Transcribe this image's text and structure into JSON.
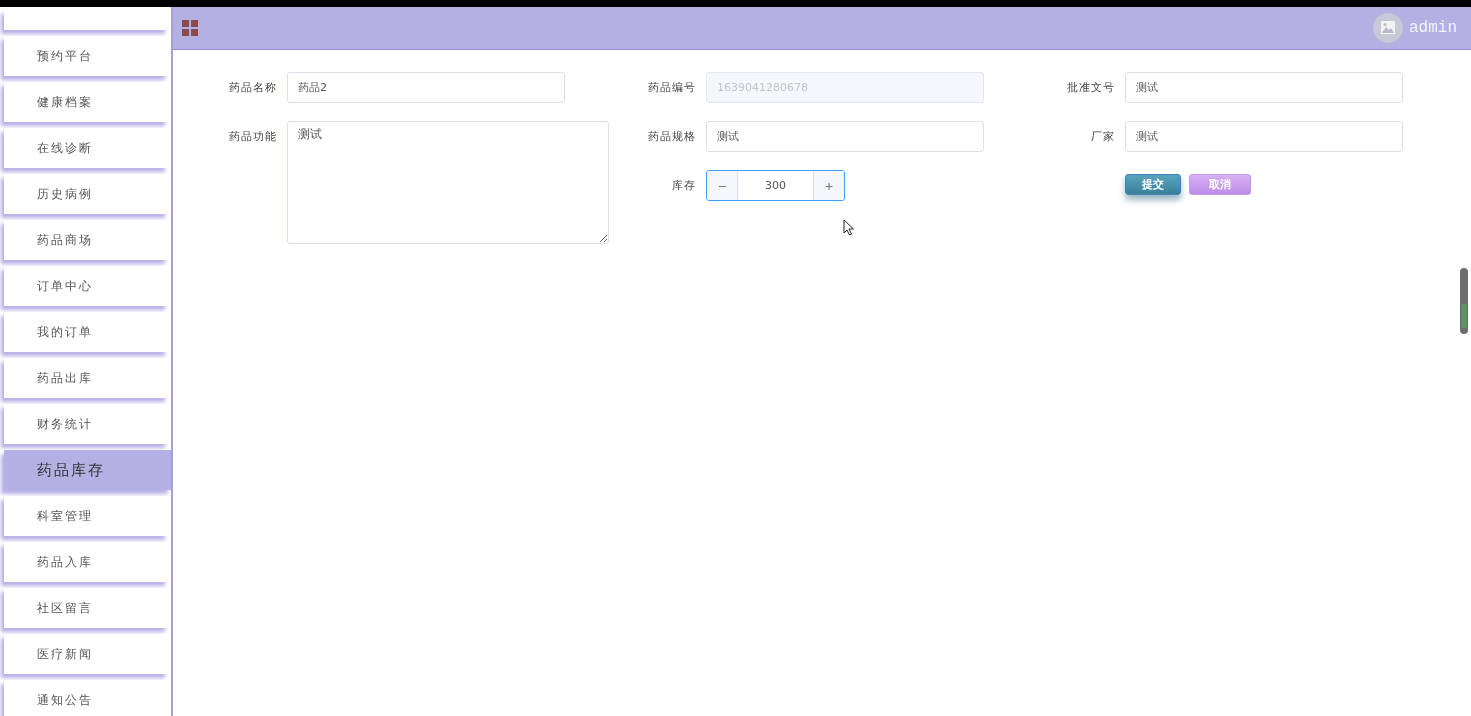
{
  "sidebar": {
    "items": [
      {
        "label": "预约平台",
        "selected": false
      },
      {
        "label": "健康档案",
        "selected": false
      },
      {
        "label": "在线诊断",
        "selected": false
      },
      {
        "label": "历史病例",
        "selected": false
      },
      {
        "label": "药品商场",
        "selected": false
      },
      {
        "label": "订单中心",
        "selected": false
      },
      {
        "label": "我的订单",
        "selected": false
      },
      {
        "label": "药品出库",
        "selected": false
      },
      {
        "label": "财务统计",
        "selected": false
      },
      {
        "label": "药品库存",
        "selected": true
      },
      {
        "label": "科室管理",
        "selected": false
      },
      {
        "label": "药品入库",
        "selected": false
      },
      {
        "label": "社区留言",
        "selected": false
      },
      {
        "label": "医疗新闻",
        "selected": false
      },
      {
        "label": "通知公告",
        "selected": false
      }
    ]
  },
  "header": {
    "user": "admin"
  },
  "form": {
    "columns": [
      [
        {
          "label": "药品名称",
          "kind": "text",
          "value": "药品2",
          "disabled": false
        },
        {
          "label": "药品功能",
          "kind": "textarea",
          "value": "测试",
          "disabled": false
        }
      ],
      [
        {
          "label": "药品编号",
          "kind": "text",
          "value": "1639041280678",
          "disabled": true
        },
        {
          "label": "药品规格",
          "kind": "text",
          "value": "测试",
          "disabled": false
        },
        {
          "label": "库存",
          "kind": "number",
          "value": "300",
          "minus": "−",
          "plus": "+",
          "disabled": false
        }
      ],
      [
        {
          "label": "批准文号",
          "kind": "text",
          "value": "测试",
          "disabled": false
        },
        {
          "label": "厂家",
          "kind": "text",
          "value": "测试",
          "disabled": false
        },
        {
          "kind": "buttons",
          "buttons": [
            {
              "label": "提交",
              "kind": "primary"
            },
            {
              "label": "取消",
              "kind": "cancel"
            }
          ]
        }
      ]
    ]
  }
}
